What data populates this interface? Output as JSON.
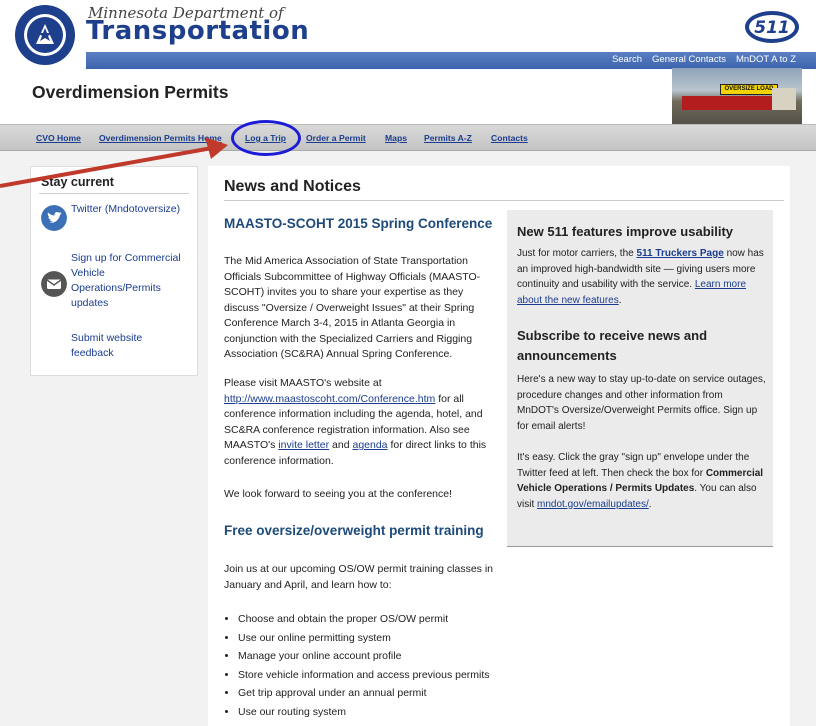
{
  "header": {
    "agency_script": "Minnesota Department of",
    "agency_name": "Transportation",
    "logo_511": "511",
    "page_title": "Overdimension Permits",
    "util_links": [
      "Search",
      "General Contacts",
      "MnDOT A to Z"
    ],
    "truck_sign": "OVERSIZE LOAD"
  },
  "nav": {
    "items": [
      "CVO Home",
      "Overdimension Permits Home",
      "Log a Trip",
      "Order a Permit",
      "Maps",
      "Permits A-Z",
      "Contacts"
    ],
    "highlighted": "Log a Trip"
  },
  "sidebar": {
    "heading": "Stay current",
    "twitter_label": "Twitter (Mndotoversize)",
    "signup_label": "Sign up for Commercial Vehicle Operations/Permits updates",
    "feedback_label": "Submit website feedback"
  },
  "main": {
    "heading": "News and Notices",
    "article1": {
      "title": "MAASTO-SCOHT 2015 Spring Conference",
      "p1": "The Mid America Association of State Transportation Officials Subcommittee of Highway Officials (MAASTO-SCOHT) invites you to share your expertise as they discuss \"Oversize / Overweight Issues\" at their Spring Conference March 3-4, 2015 in Atlanta Georgia in conjunction with the Specialized Carriers and Rigging Association (SC&RA) Annual Spring Conference.",
      "p2_start": "Please visit MAASTO's website at",
      "p2_link": "http://www.maastoscoht.com/Conference.htm",
      "p2_mid": "for all conference information including the agenda, hotel, and SC&RA conference registration information. Also see MAASTO's",
      "p2_link2": "invite letter",
      "p2_and": "and",
      "p2_link3": "agenda",
      "p2_end": "for direct links to this conference information.",
      "p3": "We look forward to seeing you at the conference!"
    },
    "article2": {
      "title": "Free oversize/overweight permit training",
      "intro": "Join us at our upcoming OS/OW permit training classes in January and April, and learn how to:",
      "bullets": [
        "Choose and obtain the proper OS/OW permit",
        "Use our online permitting system",
        "Manage your online account profile",
        "Store vehicle information and access previous permits",
        "Get trip approval under an annual permit",
        "Use our routing system"
      ]
    }
  },
  "right_box": {
    "head1": "New 511 features improve usability",
    "t1_start": "Just for motor carriers, the",
    "t1_link": "511 Truckers Page",
    "t1_end": "now has an improved high-bandwidth site — giving users more continuity and usability with the service.",
    "t1_link2": "Learn more about the new features",
    "head2": "Subscribe to receive news and announcements",
    "t2": "Here's a new way to stay up-to-date on service outages, procedure changes and other information from MnDOT's Oversize/Overweight Permits office. Sign up for email alerts!",
    "t3_start": "It's easy. Click the gray \"sign up\" envelope under the Twitter feed at left. Then check the box for",
    "t3_bold": "Commercial Vehicle Operations / Permits Updates",
    "t3_mid": ". You can also visit",
    "t3_link": "mndot.gov/emailupdates/",
    "t3_end": "."
  },
  "colors": {
    "brand_blue": "#1d3f8c",
    "link": "#1a3d8f",
    "title_blue": "#1d4a7a",
    "highlight_circle": "#1c1cd6",
    "arrow": "#c0392b"
  }
}
